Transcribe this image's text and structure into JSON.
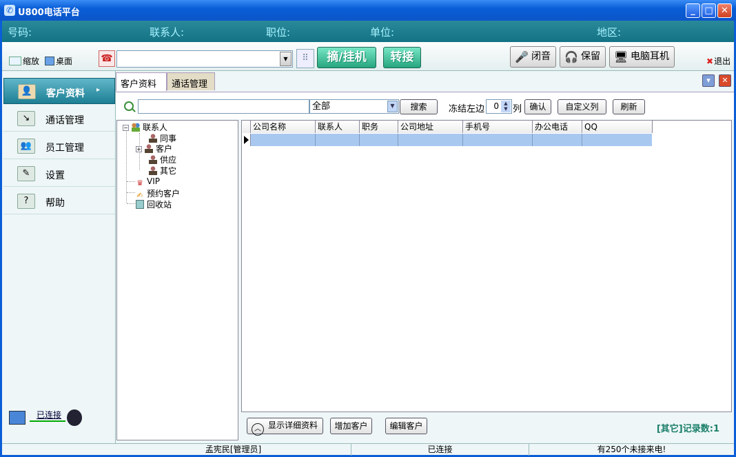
{
  "window": {
    "title": "U800电话平台",
    "icon": "phone-app-icon"
  },
  "info_bar": {
    "number_label": "号码:",
    "contact_label": "联系人:",
    "position_label": "职位:",
    "company_label": "单位:",
    "region_label": "地区:"
  },
  "toolbar": {
    "zoom_label": "缩放",
    "desktop_label": "桌面",
    "dial_value": "",
    "pickup_hangup_label": "摘/挂机",
    "transfer_label": "转接",
    "mute_label": "闭音",
    "hold_label": "保留",
    "headset_label": "电脑耳机",
    "exit_label": "退出"
  },
  "sidebar": {
    "items": [
      {
        "label": "客户资料",
        "icon": "contacts-card-icon",
        "active": true
      },
      {
        "label": "通话管理",
        "icon": "call-log-icon",
        "active": false
      },
      {
        "label": "员工管理",
        "icon": "staff-icon",
        "active": false
      },
      {
        "label": "设置",
        "icon": "settings-icon",
        "active": false
      },
      {
        "label": "帮助",
        "icon": "help-icon",
        "active": false
      }
    ],
    "connection_status": "已连接"
  },
  "tabs": [
    {
      "label": "客户资料",
      "active": true
    },
    {
      "label": "通话管理",
      "active": false
    }
  ],
  "search": {
    "value": "",
    "filter_selected": "全部",
    "search_button": "搜索",
    "freeze_label": "冻结左边",
    "freeze_value": "0",
    "column_unit": "列",
    "confirm_button": "确认",
    "custom_columns_button": "自定义列",
    "refresh_button": "刷新"
  },
  "tree": {
    "root": "联系人",
    "children": [
      "同事",
      "客户",
      "供应",
      "其它"
    ],
    "others": [
      "VIP",
      "预约客户",
      "回收站"
    ]
  },
  "grid": {
    "columns": [
      "公司名称",
      "联系人",
      "职务",
      "公司地址",
      "手机号",
      "办公电话",
      "QQ"
    ],
    "rows": [
      [
        "",
        "",
        "",
        "",
        "",
        "",
        ""
      ]
    ]
  },
  "bottom": {
    "show_details_button": "显示详细资料",
    "add_customer_button": "增加客户",
    "edit_customer_button": "编辑客户",
    "record_count": "[其它]记录数:1"
  },
  "statusbar": {
    "user": "孟宪民[管理员]",
    "connection": "已连接",
    "missed_calls": "有250个未接来电!"
  }
}
